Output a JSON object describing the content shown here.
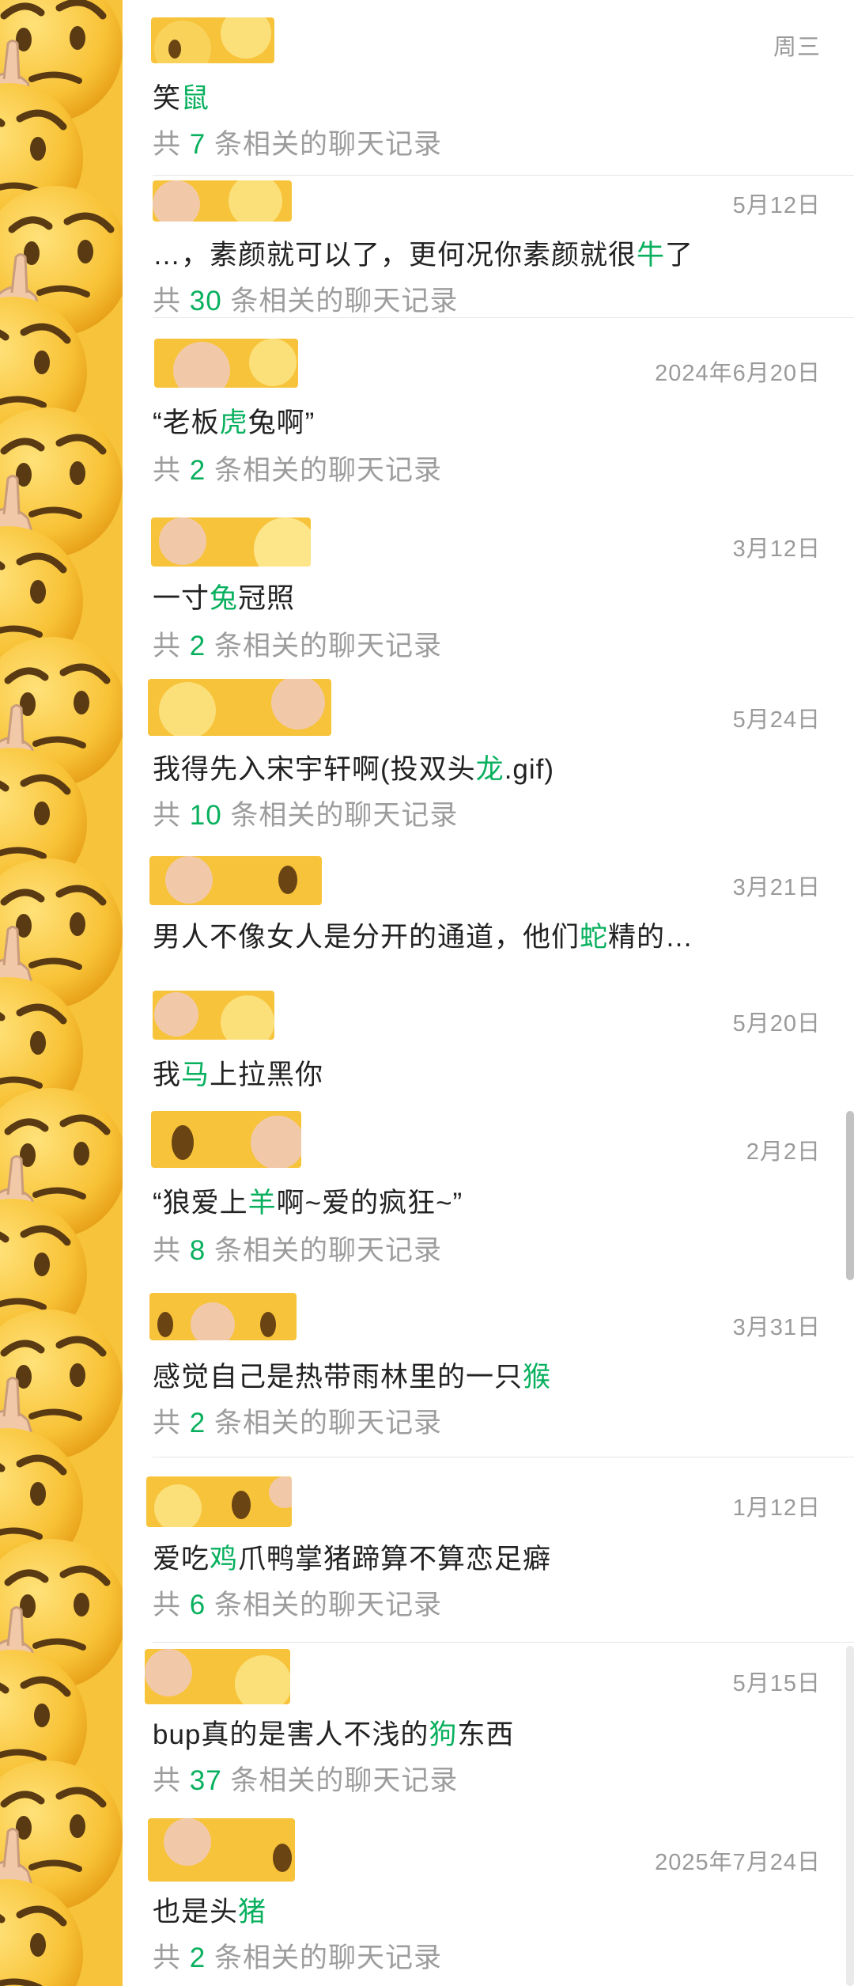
{
  "accent_color": "#08b05e",
  "rail_icon": "thinking-emoji-icon",
  "avatar_icon": "thinking-emoji-avatar",
  "results": [
    {
      "date": "周三",
      "pre": "笑",
      "hl": "鼠",
      "post": "",
      "count_pre": "共",
      "count": "7",
      "count_post": "条相关的聊天记录"
    },
    {
      "date": "5月12日",
      "pre": "…，素颜就可以了，更何况你素颜就很",
      "hl": "牛",
      "post": "了",
      "count_pre": "共",
      "count": "30",
      "count_post": "条相关的聊天记录"
    },
    {
      "date": "2024年6月20日",
      "pre": "“老板",
      "hl": "虎",
      "post": "兔啊”",
      "count_pre": "共",
      "count": "2",
      "count_post": "条相关的聊天记录"
    },
    {
      "date": "3月12日",
      "pre": "一寸",
      "hl": "兔",
      "post": "冠照",
      "count_pre": "共",
      "count": "2",
      "count_post": "条相关的聊天记录"
    },
    {
      "date": "5月24日",
      "pre": "我得先入宋宇轩啊(投双头",
      "hl": "龙",
      "post": ".gif)",
      "count_pre": "共",
      "count": "10",
      "count_post": "条相关的聊天记录"
    },
    {
      "date": "3月21日",
      "pre": "男人不像女人是分开的通道，他们",
      "hl": "蛇",
      "post": "精的…",
      "count_pre": "",
      "count": "",
      "count_post": ""
    },
    {
      "date": "5月20日",
      "pre": "我",
      "hl": "马",
      "post": "上拉黑你",
      "count_pre": "",
      "count": "",
      "count_post": ""
    },
    {
      "date": "2月2日",
      "pre": "“狼爱上",
      "hl": "羊",
      "post": "啊~爱的疯狂~”",
      "count_pre": "共",
      "count": "8",
      "count_post": "条相关的聊天记录"
    },
    {
      "date": "3月31日",
      "pre": "感觉自己是热带雨林里的一只",
      "hl": "猴",
      "post": "",
      "count_pre": "共",
      "count": "2",
      "count_post": "条相关的聊天记录"
    },
    {
      "date": "1月12日",
      "pre": "爱吃",
      "hl": "鸡",
      "post": "爪鸭掌猪蹄算不算恋足癖",
      "count_pre": "共",
      "count": "6",
      "count_post": "条相关的聊天记录"
    },
    {
      "date": "5月15日",
      "pre": "bup真的是害人不浅的",
      "hl": "狗",
      "post": "东西",
      "count_pre": "共",
      "count": "37",
      "count_post": "条相关的聊天记录"
    },
    {
      "date": "2025年7月24日",
      "pre": "也是头",
      "hl": "猪",
      "post": "",
      "count_pre": "共",
      "count": "2",
      "count_post": "条相关的聊天记录"
    }
  ]
}
